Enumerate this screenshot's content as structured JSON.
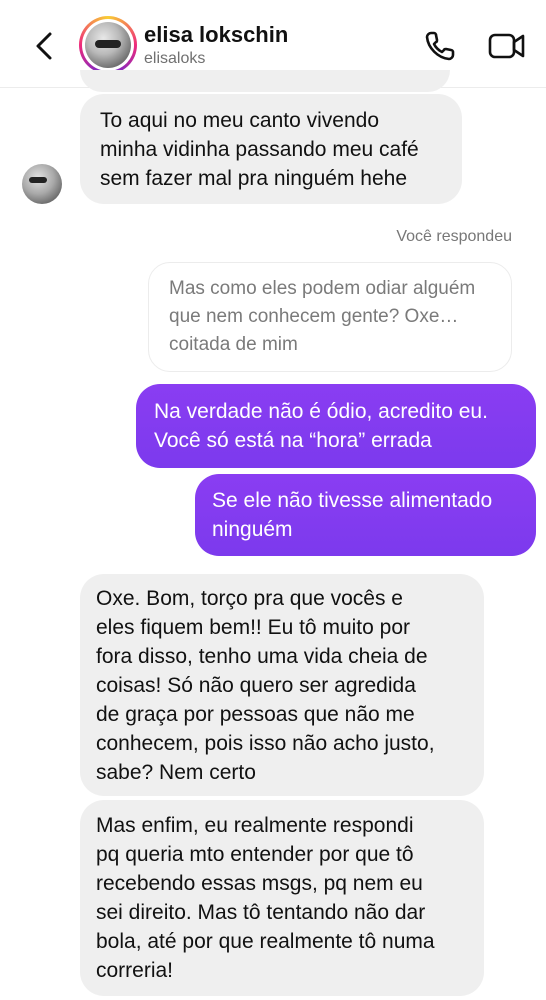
{
  "header": {
    "name": "elisa lokschin",
    "handle": "elisaloks"
  },
  "messages": {
    "m1": [
      "To aqui no meu canto vivendo",
      "minha vidinha passando meu café",
      "sem fazer mal pra ninguém hehe"
    ],
    "reply_label": "Você respondeu",
    "quoted": [
      "Mas como eles podem odiar alguém",
      "que nem conhecem gente? Oxe…",
      "coitada de mim"
    ],
    "m2": [
      "Na verdade não é ódio, acredito eu.",
      "Você só está na “hora” errada"
    ],
    "m3": [
      "Se ele não tivesse alimentado",
      "ninguém"
    ],
    "m4": [
      "Oxe. Bom, torço pra que vocês e",
      "eles fiquem bem!! Eu tô muito por",
      "fora disso, tenho uma vida cheia de",
      "coisas! Só não quero ser agredida",
      "de graça por pessoas que não me",
      "conhecem, pois isso não acho justo,",
      "sabe? Nem certo"
    ],
    "m5": [
      "Mas enfim, eu realmente respondi",
      "pq queria mto entender por que tô",
      "recebendo essas msgs, pq nem eu",
      "sei direito. Mas tô tentando não dar",
      "bola, até por que realmente tô numa",
      "correria!"
    ]
  },
  "colors": {
    "outgoing": "#7c3aed",
    "incoming": "#efefef"
  },
  "icons": {
    "back": "chevron-left-icon",
    "phone": "phone-icon",
    "video": "video-camera-icon"
  }
}
